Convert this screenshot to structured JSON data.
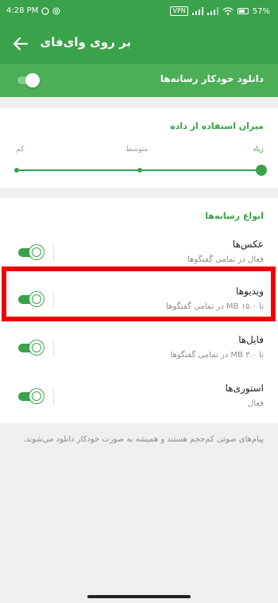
{
  "status_bar": {
    "time": "4:28 PM",
    "vpn": "VPN",
    "battery": "57%"
  },
  "app_bar": {
    "title": "بر روی وای‌فای"
  },
  "auto_download": {
    "label": "دانلود خودکار رسانه‌ها",
    "enabled": true
  },
  "data_usage": {
    "title": "میزان استفاده از داده",
    "levels": [
      "کم",
      "متوسط",
      "زیاد"
    ],
    "selected_level": "زیاد"
  },
  "media_types": {
    "title": "انواع رسانه‌ها",
    "rows": [
      {
        "name": "عکس‌ها",
        "description": "فعال در تمامی گفتگوها",
        "enabled": true
      },
      {
        "name": "ویدیوها",
        "description": "تا ۱۵.۰ MB در تمامی گفتگوها",
        "enabled": true
      },
      {
        "name": "فایل‌ها",
        "description": "تا ۳.۰ MB در تمامی گفتگوها",
        "enabled": true
      },
      {
        "name": "استوری‌ها",
        "description": "فعال",
        "enabled": true
      }
    ]
  },
  "footer_note": "پیام‌های صوتی کم‌حجم هستند و همیشه به صورت خودکار دانلود می‌شوند.",
  "colors": {
    "primary": "#3aa24a",
    "auto_bar": "#4cae56",
    "highlight": "#ee0000",
    "background": "#efefef"
  }
}
